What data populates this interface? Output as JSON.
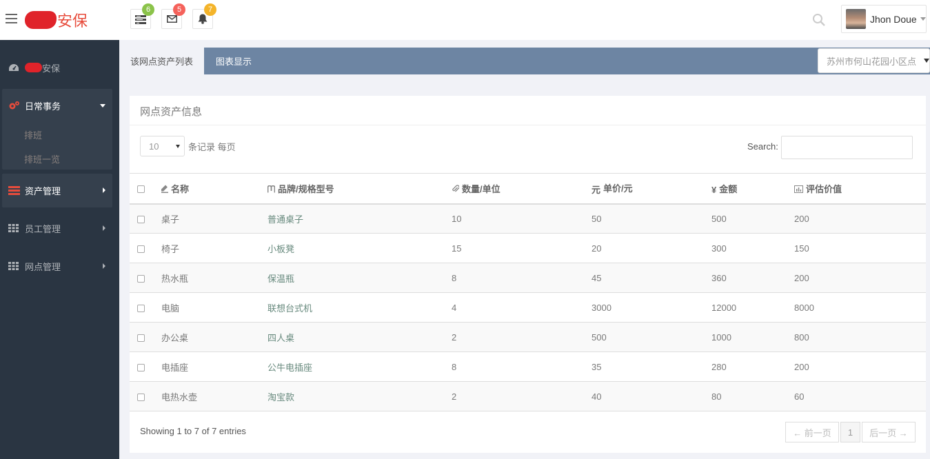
{
  "header": {
    "brand_suffix": "安保",
    "icons": [
      {
        "icon": "tasks-icon",
        "badge": "6",
        "color": "#8bc34a"
      },
      {
        "icon": "envelope-icon",
        "badge": "5",
        "color": "#f5625b"
      },
      {
        "icon": "bell-icon",
        "badge": "7",
        "color": "#f4b42a"
      }
    ],
    "user_name": "Jhon Doue"
  },
  "sidebar": {
    "dashboard_label": "安保",
    "groups": [
      {
        "label": "日常事务",
        "sub": [
          "排班",
          "排班一览"
        ]
      },
      {
        "label": "资产管理"
      },
      {
        "label": "员工管理"
      },
      {
        "label": "网点管理"
      }
    ]
  },
  "tabs": {
    "active": "该网点资产列表",
    "other": "图表显示"
  },
  "site_select": {
    "value": "苏州市何山花园小区点"
  },
  "panel": {
    "title": "网点资产信息",
    "page_length": "10",
    "page_length_label": "条记录 每页",
    "search_label": "Search:",
    "columns": [
      "名称",
      "品牌/规格型号",
      "数量/单位",
      "单价/元",
      "金额",
      "评估价值"
    ],
    "column_icons": [
      "name-icon",
      "brand-icon",
      "paperclip-icon",
      "yuan-icon",
      "yen-icon",
      "bar-chart-icon"
    ],
    "column_prefixes": [
      "",
      "",
      "",
      "元",
      "¥",
      ""
    ],
    "rows": [
      [
        "桌子",
        "普通桌子",
        "10",
        "50",
        "500",
        "200"
      ],
      [
        "椅子",
        "小板凳",
        "15",
        "20",
        "300",
        "150"
      ],
      [
        "热水瓶",
        "保温瓶",
        "8",
        "45",
        "360",
        "200"
      ],
      [
        "电脑",
        "联想台式机",
        "4",
        "3000",
        "12000",
        "8000"
      ],
      [
        "办公桌",
        "四人桌",
        "2",
        "500",
        "1000",
        "800"
      ],
      [
        "电插座",
        "公牛电插座",
        "8",
        "35",
        "280",
        "200"
      ],
      [
        "电热水壶",
        "淘宝款",
        "2",
        "40",
        "80",
        "60"
      ]
    ],
    "info": "Showing 1 to 7 of 7 entries",
    "pagination": {
      "prev": "← 前一页",
      "current": "1",
      "next": "后一页 →"
    }
  }
}
